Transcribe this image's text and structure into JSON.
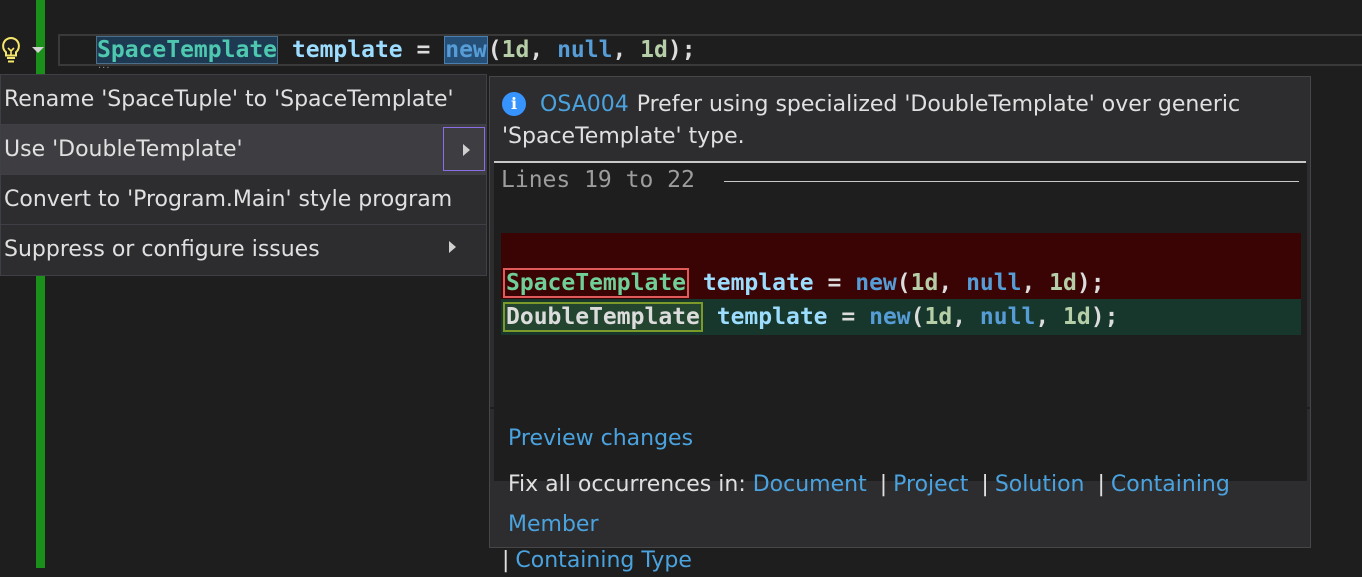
{
  "editor": {
    "code_tokens": {
      "type": "SpaceTemplate",
      "ident": "template",
      "eq": "=",
      "kw_new": "new",
      "open": "(",
      "arg1": "1d",
      "comma1": ",",
      "arg2": "null",
      "comma2": ",",
      "arg3": "1d",
      "close": ");"
    },
    "dots": "...",
    "gutter_color": "#1a8f1a"
  },
  "lightbulb": {
    "icon": "lightbulb-icon"
  },
  "menu": {
    "items": [
      {
        "label": "Rename 'SpaceTuple' to 'SpaceTemplate'"
      },
      {
        "label": "Use 'DoubleTemplate'"
      },
      {
        "label": "Convert to 'Program.Main' style program"
      },
      {
        "label": "Suppress or configure issues"
      }
    ]
  },
  "preview": {
    "diagnostic": {
      "icon": "info-icon",
      "icon_glyph": "i",
      "id": "OSA004",
      "message": "Prefer using specialized 'DoubleTemplate' over generic 'SpaceTemplate' type."
    },
    "lines_label": "Lines 19 to 22",
    "old_line": {
      "type": "SpaceTemplate",
      "rest_ident": "template",
      "eq": "=",
      "kw_new": "new",
      "open": "(",
      "arg1": "1d",
      "comma1": ",",
      "arg2": "null",
      "comma2": ",",
      "arg3": "1d",
      "close": ");"
    },
    "new_line": {
      "type": "DoubleTemplate",
      "rest_ident": "template",
      "eq": "=",
      "kw_new": "new",
      "open": "(",
      "arg1": "1d",
      "comma1": ",",
      "arg2": "null",
      "comma2": ",",
      "arg3": "1d",
      "close": ");"
    },
    "preview_changes": "Preview changes",
    "fix_all_label": "Fix all occurrences in:",
    "scopes": [
      "Document",
      "Project",
      "Solution",
      "Containing Member",
      "Containing Type"
    ],
    "pipe": "|"
  }
}
